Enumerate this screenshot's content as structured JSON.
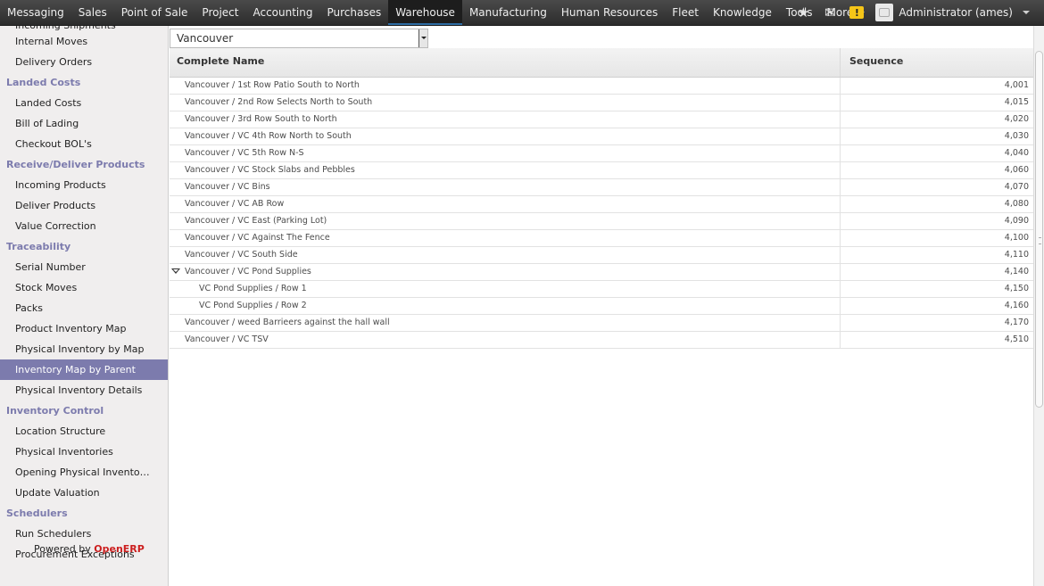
{
  "topbar": {
    "menu": [
      {
        "label": "Messaging"
      },
      {
        "label": "Sales"
      },
      {
        "label": "Point of Sale"
      },
      {
        "label": "Project"
      },
      {
        "label": "Accounting"
      },
      {
        "label": "Purchases"
      },
      {
        "label": "Warehouse",
        "active": true
      },
      {
        "label": "Manufacturing"
      },
      {
        "label": "Human Resources"
      },
      {
        "label": "Fleet"
      },
      {
        "label": "Knowledge"
      },
      {
        "label": "Tools"
      }
    ],
    "more_label": "More",
    "star_icon": "★",
    "mail_icon": "✉",
    "warn_icon": "!",
    "user_name": "Administrator (ames)"
  },
  "sidebar": {
    "cut_item": "Incoming Shipments",
    "top_items": [
      "Internal Moves",
      "Delivery Orders"
    ],
    "sections": [
      {
        "title": "Landed Costs",
        "items": [
          "Landed Costs",
          "Bill of Lading",
          "Checkout BOL's"
        ]
      },
      {
        "title": "Receive/Deliver Products",
        "items": [
          "Incoming Products",
          "Deliver Products",
          "Value Correction"
        ]
      },
      {
        "title": "Traceability",
        "items": [
          "Serial Number",
          "Stock Moves",
          "Packs",
          "Product Inventory Map",
          "Physical Inventory by Map",
          "Inventory Map by Parent",
          "Physical Inventory Details"
        ]
      },
      {
        "title": "Inventory Control",
        "items": [
          "Location Structure",
          "Physical Inventories",
          "Opening Physical Inventor…",
          "Update Valuation"
        ]
      },
      {
        "title": "Schedulers",
        "items": [
          "Run Schedulers",
          "Procurement Exceptions"
        ]
      }
    ],
    "active_item": "Inventory Map by Parent",
    "powered_by": "Powered by",
    "powered_brand": "OpenERP"
  },
  "selector": {
    "value": "Vancouver"
  },
  "table": {
    "headers": {
      "name": "Complete Name",
      "sequence": "Sequence"
    },
    "rows": [
      {
        "name": "Vancouver / 1st Row Patio South to North",
        "seq": "4,001",
        "level": 0
      },
      {
        "name": "Vancouver / 2nd Row Selects North to South",
        "seq": "4,015",
        "level": 0
      },
      {
        "name": "Vancouver / 3rd Row South to North",
        "seq": "4,020",
        "level": 0
      },
      {
        "name": "Vancouver / VC 4th Row North to South",
        "seq": "4,030",
        "level": 0
      },
      {
        "name": "Vancouver / VC 5th Row N-S",
        "seq": "4,040",
        "level": 0
      },
      {
        "name": "Vancouver / VC Stock Slabs and Pebbles",
        "seq": "4,060",
        "level": 0
      },
      {
        "name": "Vancouver / VC Bins",
        "seq": "4,070",
        "level": 0
      },
      {
        "name": "Vancouver / VC AB Row",
        "seq": "4,080",
        "level": 0
      },
      {
        "name": "Vancouver / VC East (Parking Lot)",
        "seq": "4,090",
        "level": 0
      },
      {
        "name": "Vancouver / VC Against The Fence",
        "seq": "4,100",
        "level": 0
      },
      {
        "name": "Vancouver / VC South Side",
        "seq": "4,110",
        "level": 0
      },
      {
        "name": "Vancouver / VC Pond Supplies",
        "seq": "4,140",
        "level": 0,
        "expanded": true
      },
      {
        "name": "VC Pond Supplies / Row 1",
        "seq": "4,150",
        "level": 1
      },
      {
        "name": "VC Pond Supplies / Row 2",
        "seq": "4,160",
        "level": 1
      },
      {
        "name": "Vancouver / weed Barrieers against the hall wall",
        "seq": "4,170",
        "level": 0
      },
      {
        "name": "Vancouver / VC TSV",
        "seq": "4,510",
        "level": 0
      }
    ]
  }
}
